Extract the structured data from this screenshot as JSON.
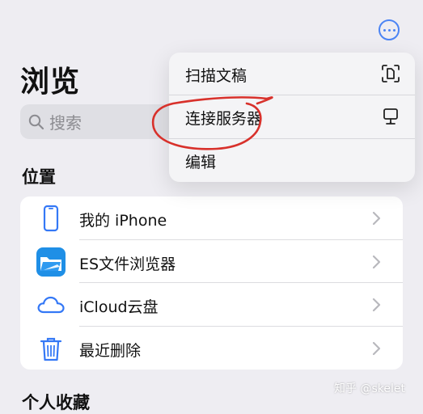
{
  "header": {
    "title": "浏览",
    "more_icon": "ellipsis-circle-icon"
  },
  "search": {
    "placeholder": "搜索"
  },
  "locations": {
    "title": "位置",
    "items": [
      {
        "label": "我的 iPhone",
        "icon": "iphone-icon"
      },
      {
        "label": "ES文件浏览器",
        "icon": "es-file-explorer-icon"
      },
      {
        "label": "iCloud云盘",
        "icon": "cloud-icon"
      },
      {
        "label": "最近删除",
        "icon": "trash-icon"
      }
    ]
  },
  "favorites": {
    "title": "个人收藏"
  },
  "context_menu": {
    "items": [
      {
        "label": "扫描文稿",
        "icon": "doc-scan-icon"
      },
      {
        "label": "连接服务器",
        "icon": "server-display-icon"
      },
      {
        "label": "编辑"
      }
    ]
  },
  "watermark": "知乎 @skelet",
  "colors": {
    "accent": "#4b84f4",
    "background": "#eeedf2",
    "annotation": "#d8312b"
  }
}
